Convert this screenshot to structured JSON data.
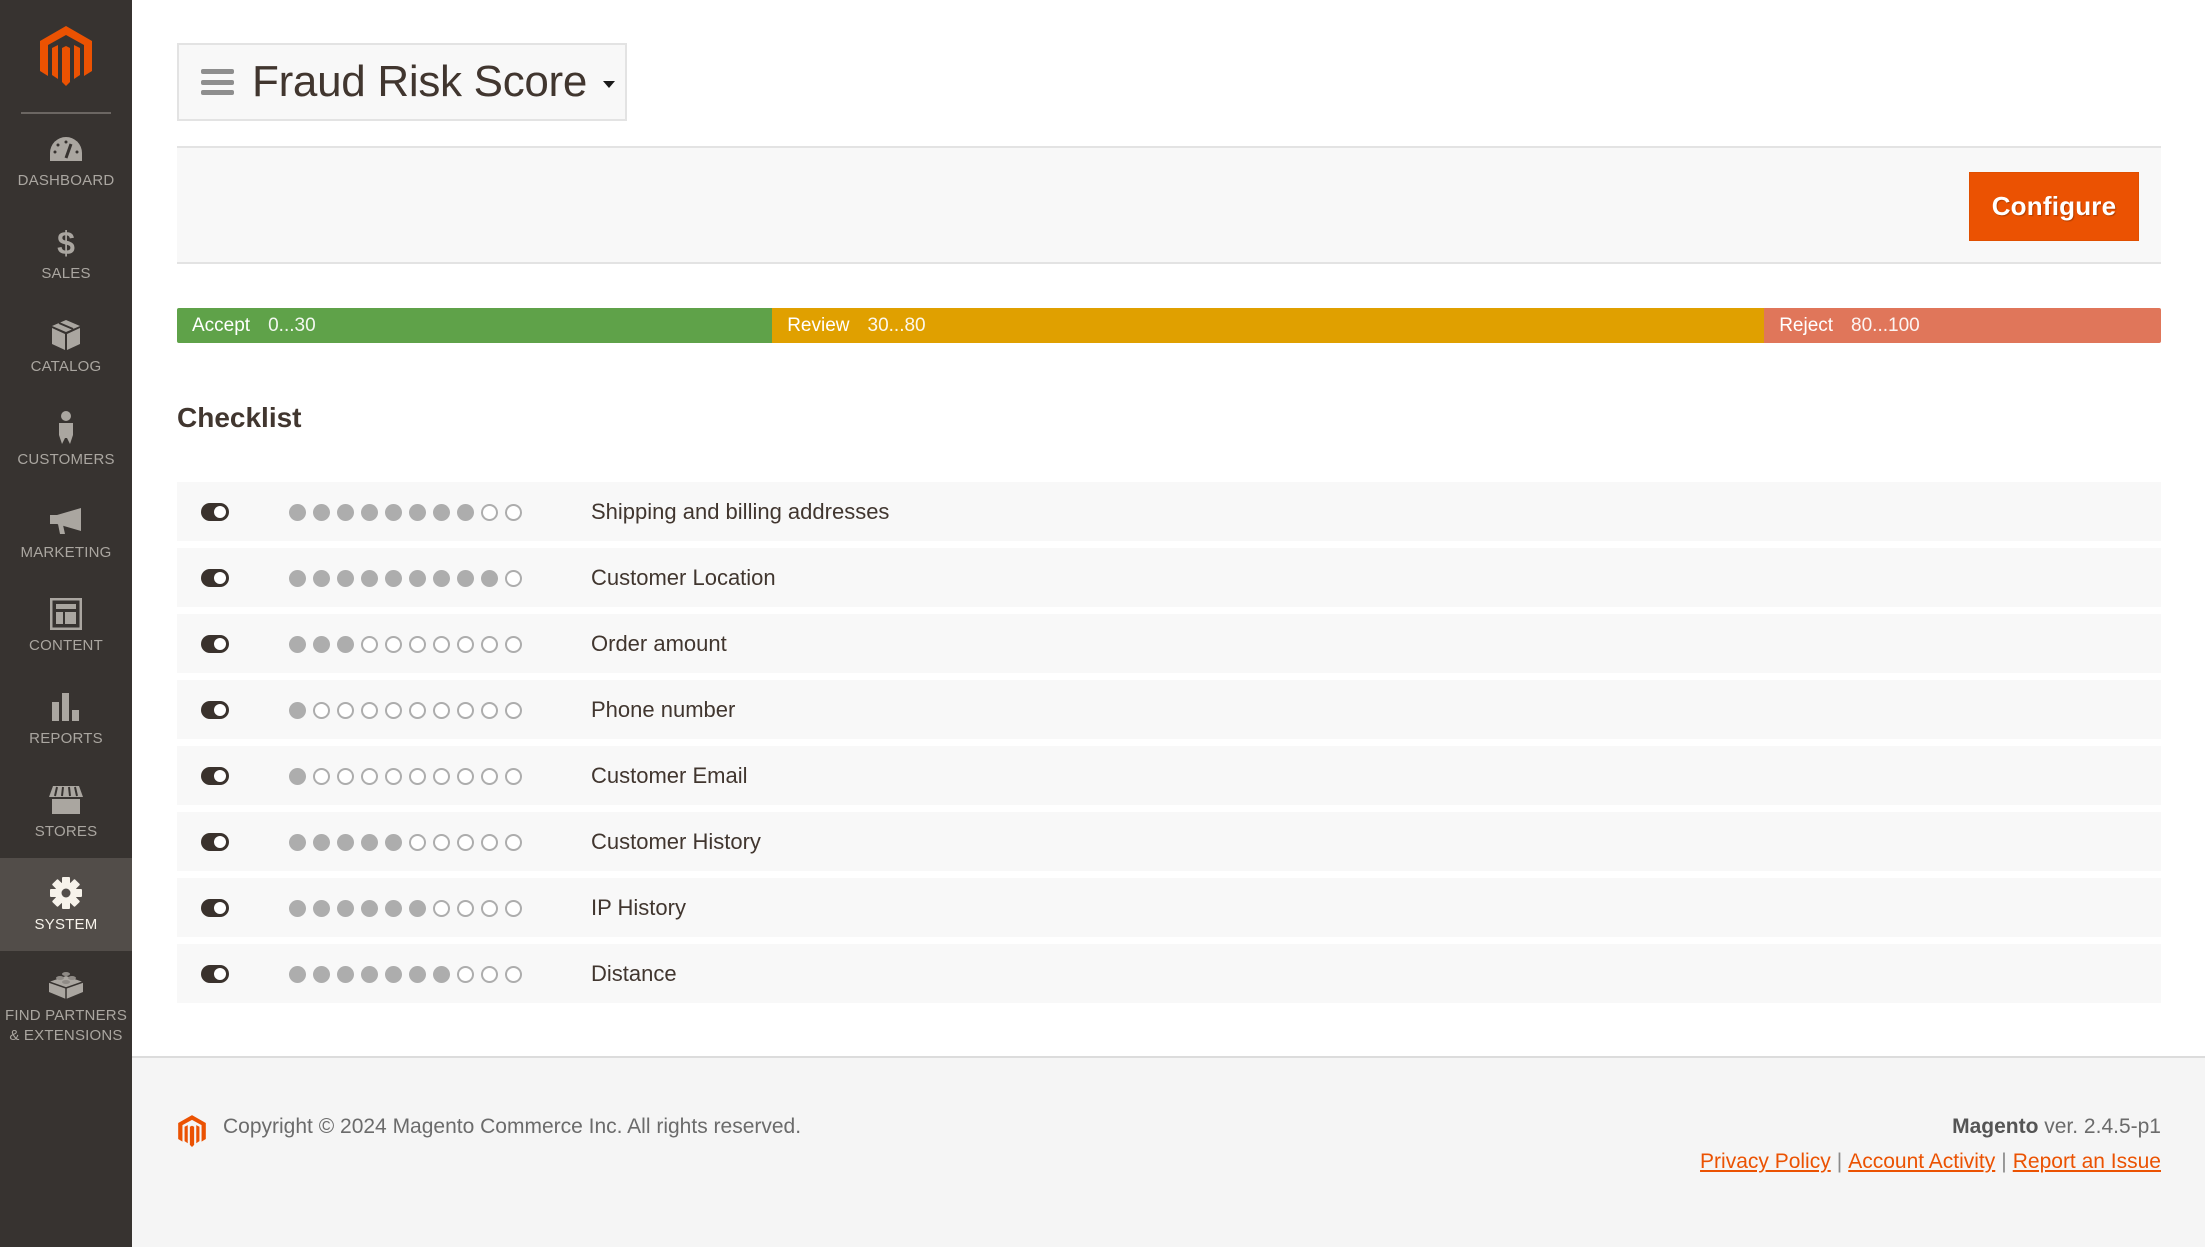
{
  "sidebar": {
    "logo": "magento-logo-icon",
    "items": [
      {
        "label": "DASHBOARD",
        "icon": "dashboard-gauge-icon",
        "active": false
      },
      {
        "label": "SALES",
        "icon": "dollar-icon",
        "active": false
      },
      {
        "label": "CATALOG",
        "icon": "box-icon",
        "active": false
      },
      {
        "label": "CUSTOMERS",
        "icon": "person-icon",
        "active": false
      },
      {
        "label": "MARKETING",
        "icon": "megaphone-icon",
        "active": false
      },
      {
        "label": "CONTENT",
        "icon": "layout-icon",
        "active": false
      },
      {
        "label": "REPORTS",
        "icon": "bar-chart-icon",
        "active": false
      },
      {
        "label": "STORES",
        "icon": "storefront-icon",
        "active": false
      },
      {
        "label": "SYSTEM",
        "icon": "gear-icon",
        "active": true
      },
      {
        "label": "FIND PARTNERS & EXTENSIONS",
        "label_line1": "FIND PARTNERS",
        "label_line2": "& EXTENSIONS",
        "icon": "lego-brick-icon",
        "active": false
      }
    ]
  },
  "header": {
    "title": "Fraud Risk Score",
    "menu_icon": "hamburger-icon",
    "dropdown_icon": "caret-down-icon"
  },
  "actions": {
    "configure_label": "Configure"
  },
  "score_bar": {
    "segments": [
      {
        "label": "Accept",
        "range": "0...30",
        "from": 0,
        "to": 30,
        "color": "#5fa249"
      },
      {
        "label": "Review",
        "range": "30...80",
        "from": 30,
        "to": 80,
        "color": "#e0a000"
      },
      {
        "label": "Reject",
        "range": "80...100",
        "from": 80,
        "to": 100,
        "color": "#e0765a"
      }
    ]
  },
  "checklist": {
    "title": "Checklist",
    "max_score": 10,
    "rows": [
      {
        "label": "Shipping and billing addresses",
        "score": 8,
        "enabled": true
      },
      {
        "label": "Customer Location",
        "score": 9,
        "enabled": true
      },
      {
        "label": "Order amount",
        "score": 3,
        "enabled": true
      },
      {
        "label": "Phone number",
        "score": 1,
        "enabled": true
      },
      {
        "label": "Customer Email",
        "score": 1,
        "enabled": true
      },
      {
        "label": "Customer History",
        "score": 5,
        "enabled": true
      },
      {
        "label": "IP History",
        "score": 6,
        "enabled": true
      },
      {
        "label": "Distance",
        "score": 7,
        "enabled": true
      }
    ]
  },
  "footer": {
    "copyright": "Copyright © 2024 Magento Commerce Inc. All rights reserved.",
    "brand": "Magento",
    "version": "ver. 2.4.5-p1",
    "links": [
      {
        "label": "Privacy Policy"
      },
      {
        "label": "Account Activity"
      },
      {
        "label": "Report an Issue"
      }
    ],
    "separator": "|"
  },
  "colors": {
    "accent": "#eb5202",
    "sidebar_bg": "#373330",
    "sidebar_active_bg": "#524d49",
    "dot_filled": "#adadad",
    "text_dark": "#41362f"
  }
}
